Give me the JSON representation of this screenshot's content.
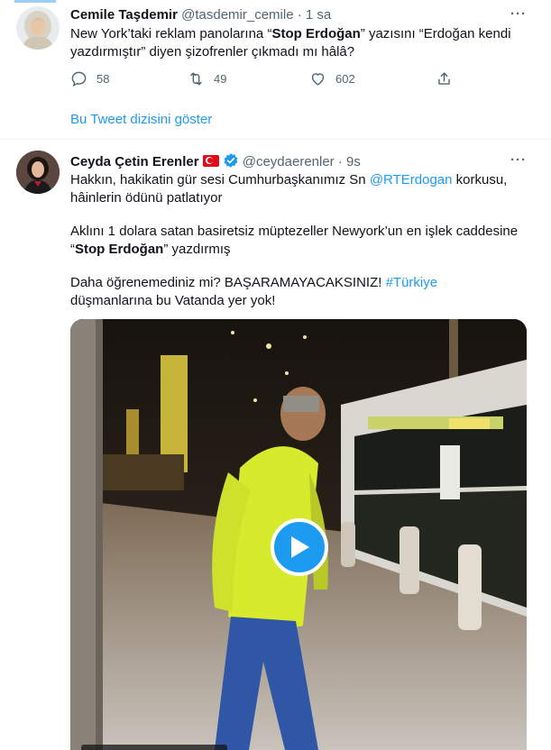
{
  "tweet1": {
    "name": "Cemile Taşdemir",
    "handle": "@tasdemir_cemile",
    "separator": "·",
    "time": "1 sa",
    "text_before": "New York’taki reklam panolarına “",
    "text_bold": "Stop Erdoğan",
    "text_after": "” yazısını “Erdoğan kendi yazdırmıştır” diyen şizofrenler çıkmadı mı hâlâ?",
    "replies": "58",
    "retweets": "49",
    "likes": "602",
    "show_thread": "Bu Tweet dizisini göster"
  },
  "tweet2": {
    "name": "Ceyda Çetin Erenler",
    "handle": "@ceydaerenler",
    "separator": "·",
    "time": "9s",
    "p1_before": "Hakkın, hakikatin gür sesi Cumhurbaşkanımız Sn ",
    "p1_mention": "@RTErdogan",
    "p1_after": " korkusu, hâinlerin ödünü patlatıyor",
    "p2_before": "Aklını 1 dolara satan basiretsiz müptezeller Newyork’un en işlek caddesine “",
    "p2_bold": "Stop Erdoğan",
    "p2_after": "” yazdırmış",
    "p3_before": "Daha öğrenemediniz mi? BAŞARAMAYACAKSINIZ! ",
    "p3_hashtag": "#Türkiye",
    "p3_after": " düşmanlarına bu Vatanda yer yok!"
  },
  "more_label": "···",
  "colors": {
    "accent": "#1d9bf0",
    "text": "#0f1419",
    "secondary": "#536471",
    "flag": "#e30a17"
  },
  "icons": {
    "reply": "reply-icon",
    "retweet": "retweet-icon",
    "like": "heart-icon",
    "share": "share-icon",
    "play": "play-icon",
    "verified": "verified-badge-icon",
    "flag": "turkey-flag-icon"
  }
}
